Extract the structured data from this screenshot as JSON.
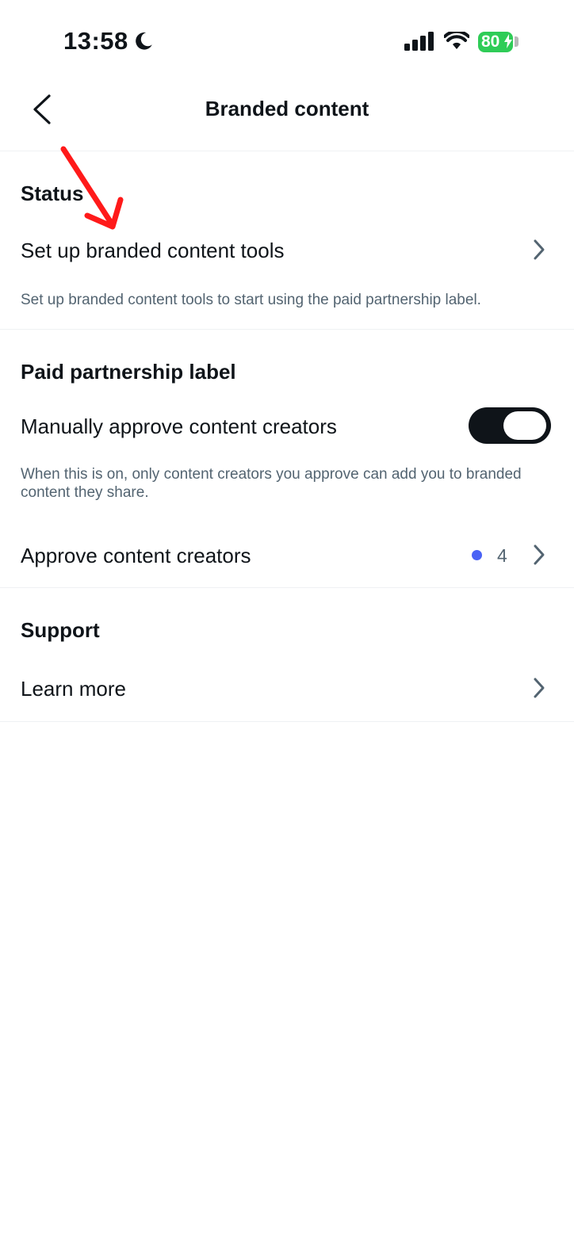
{
  "status_bar": {
    "time": "13:58",
    "battery": "80"
  },
  "nav": {
    "title": "Branded content"
  },
  "status_section": {
    "heading": "Status",
    "row_label": "Set up branded content tools",
    "description": "Set up branded content tools to start using the paid partnership label."
  },
  "paid_section": {
    "heading": "Paid partnership label",
    "toggle_label": "Manually approve content creators",
    "toggle_on": true,
    "description": "When this is on, only content creators you approve can add you to branded content they share.",
    "approve_label": "Approve content creators",
    "approve_count": "4"
  },
  "support_section": {
    "heading": "Support",
    "learn_more": "Learn more"
  },
  "colors": {
    "accent_dot": "#4a62f5",
    "battery": "#2fcc57",
    "annotation_arrow": "#ff1a1a"
  },
  "icons": [
    "moon-icon",
    "signal-icon",
    "wifi-icon",
    "back-arrow-icon",
    "chevron-right-icon",
    "annotation-arrow"
  ]
}
